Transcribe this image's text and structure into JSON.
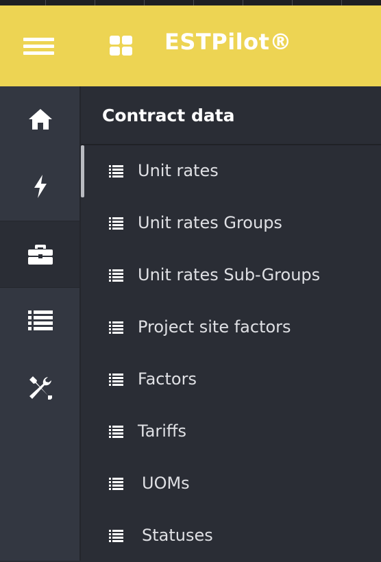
{
  "header": {
    "app_title": "ESTPilot®",
    "menu_icon": "hamburger-icon",
    "apps_icon": "grid-icon",
    "background_color": "#edd453"
  },
  "rail": {
    "items": [
      {
        "icon": "home-icon",
        "active": false
      },
      {
        "icon": "bolt-icon",
        "active": false
      },
      {
        "icon": "briefcase-icon",
        "active": true
      },
      {
        "icon": "list-icon",
        "active": false
      },
      {
        "icon": "wrench-screwdriver-icon",
        "active": false
      }
    ]
  },
  "panel": {
    "title": "Contract data",
    "items": [
      {
        "label": "Unit rates",
        "icon": "list-icon"
      },
      {
        "label": "Unit rates Groups",
        "icon": "list-icon"
      },
      {
        "label": "Unit rates Sub-Groups",
        "icon": "list-icon"
      },
      {
        "label": "Project site factors",
        "icon": "list-icon"
      },
      {
        "label": "Factors",
        "icon": "list-icon"
      },
      {
        "label": "Tariffs",
        "icon": "list-icon"
      },
      {
        "label": "UOMs",
        "icon": "list-icon"
      },
      {
        "label": "Statuses",
        "icon": "list-icon"
      }
    ]
  }
}
